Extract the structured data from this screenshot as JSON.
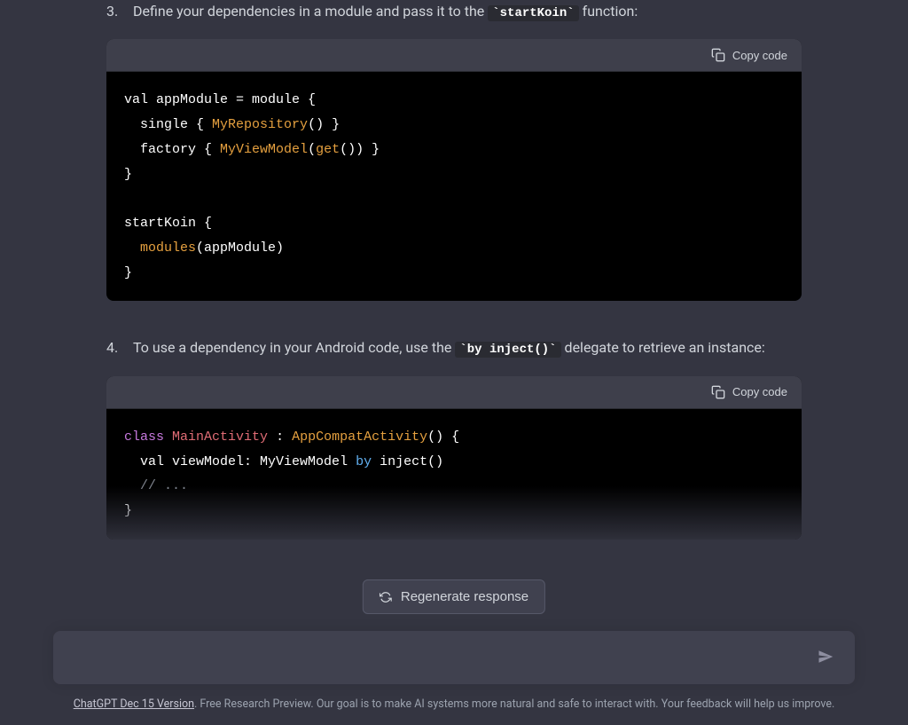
{
  "steps": [
    {
      "number": "3.",
      "text_before": "Define your dependencies in a module and pass it to the ",
      "code_inline": "`startKoin`",
      "text_after": " function:"
    },
    {
      "number": "4.",
      "text_before": "To use a dependency in your Android code, use the ",
      "code_inline": "`by inject()`",
      "text_after": " delegate to retrieve an instance:"
    }
  ],
  "copy_label": "Copy code",
  "code_block_1": {
    "tokens": [
      {
        "t": "val",
        "c": "kw-var"
      },
      {
        "t": " appModule = module {\n  single { ",
        "c": ""
      },
      {
        "t": "MyRepository",
        "c": "kw-call"
      },
      {
        "t": "() }\n  factory { ",
        "c": ""
      },
      {
        "t": "MyViewModel",
        "c": "kw-call"
      },
      {
        "t": "(",
        "c": ""
      },
      {
        "t": "get",
        "c": "kw-call"
      },
      {
        "t": "()) }\n}\n\nstartKoin {\n  ",
        "c": ""
      },
      {
        "t": "modules",
        "c": "kw-call"
      },
      {
        "t": "(appModule)\n}",
        "c": ""
      }
    ]
  },
  "code_block_2": {
    "tokens": [
      {
        "t": "class",
        "c": "kw-class"
      },
      {
        "t": " ",
        "c": ""
      },
      {
        "t": "MainActivity",
        "c": "kw-type"
      },
      {
        "t": " : ",
        "c": ""
      },
      {
        "t": "AppCompatActivity",
        "c": "kw-call"
      },
      {
        "t": "() {\n  ",
        "c": ""
      },
      {
        "t": "val",
        "c": "kw-var"
      },
      {
        "t": " viewModel: MyViewModel ",
        "c": ""
      },
      {
        "t": "by",
        "c": "kw-by"
      },
      {
        "t": " inject()\n  ",
        "c": ""
      },
      {
        "t": "// ...",
        "c": "kw-comment"
      },
      {
        "t": "\n}",
        "c": ""
      }
    ]
  },
  "regenerate_label": "Regenerate response",
  "input_placeholder": "",
  "footer": {
    "link_text": "ChatGPT Dec 15 Version",
    "rest": ". Free Research Preview. Our goal is to make AI systems more natural and safe to interact with. Your feedback will help us improve."
  }
}
